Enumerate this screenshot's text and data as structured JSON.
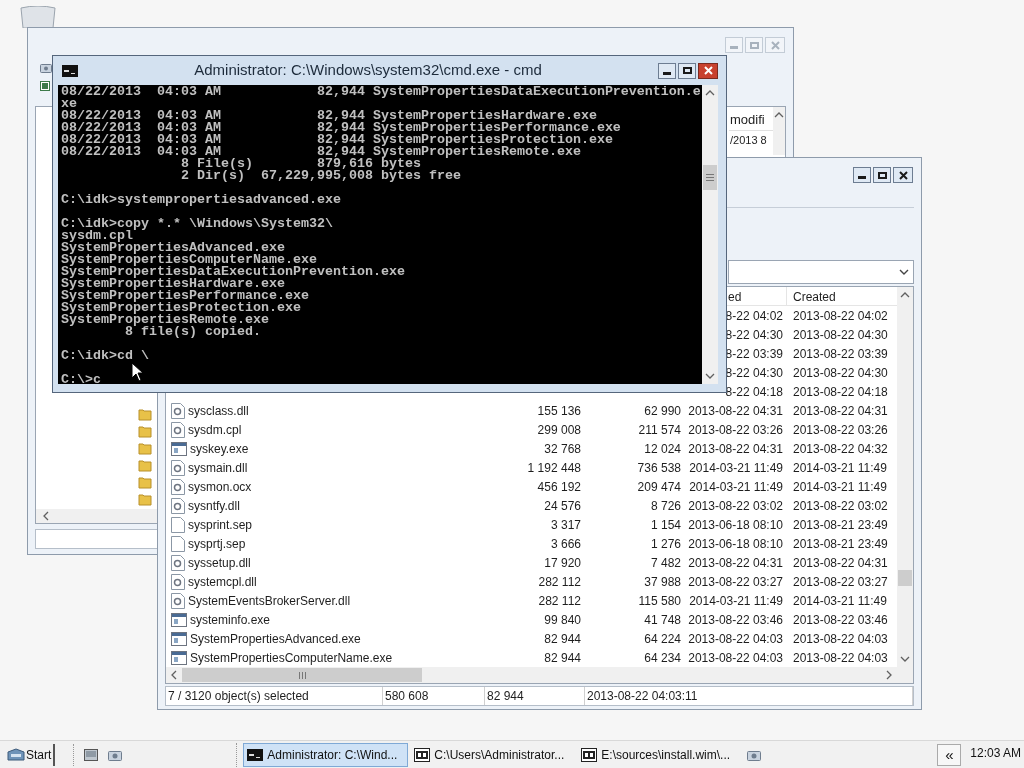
{
  "back_window": {
    "active": false,
    "list_header": "modifi",
    "list_cell": "/2013 8"
  },
  "cmd_window": {
    "title": "Administrator: C:\\Windows\\system32\\cmd.exe - cmd",
    "active": true,
    "blocks": [
      [
        "08/22/2013  04:03 AM            82,944 SystemPropertiesDataExecutionPrevention.e",
        "xe",
        "08/22/2013  04:03 AM            82,944 SystemPropertiesHardware.exe",
        "08/22/2013  04:03 AM            82,944 SystemPropertiesPerformance.exe",
        "08/22/2013  04:03 AM            82,944 SystemPropertiesProtection.exe",
        "08/22/2013  04:03 AM            82,944 SystemPropertiesRemote.exe",
        "               8 File(s)        879,616 bytes",
        "               2 Dir(s)  67,229,995,008 bytes free"
      ],
      [
        "C:\\idk>systempropertiesadvanced.exe"
      ],
      [
        "C:\\idk>copy *.* \\Windows\\System32\\",
        "sysdm.cpl",
        "SystemPropertiesAdvanced.exe",
        "SystemPropertiesComputerName.exe",
        "SystemPropertiesDataExecutionPrevention.exe",
        "SystemPropertiesHardware.exe",
        "SystemPropertiesPerformance.exe",
        "SystemPropertiesProtection.exe",
        "SystemPropertiesRemote.exe",
        "        8 file(s) copied."
      ],
      [
        "C:\\idk>cd \\"
      ],
      [
        "C:\\>c"
      ]
    ]
  },
  "file_window": {
    "active": false,
    "header": {
      "modified": "ed",
      "created": "Created"
    },
    "rows": [
      {
        "modified": "8-22 04:02",
        "created": "2013-08-22 04:02"
      },
      {
        "modified": "8-22 04:30",
        "created": "2013-08-22 04:30"
      },
      {
        "modified": "8-22 03:39",
        "created": "2013-08-22 03:39"
      },
      {
        "modified": "8-22 04:30",
        "created": "2013-08-22 04:30"
      },
      {
        "modified": "8-22 04:18",
        "created": "2013-08-22 04:18"
      },
      {
        "kind": "dll",
        "name": "sysclass.dll",
        "size": "155 136",
        "packed": "62 990",
        "modified": "2013-08-22 04:31",
        "created": "2013-08-22 04:31"
      },
      {
        "kind": "dll",
        "name": "sysdm.cpl",
        "size": "299 008",
        "packed": "211 574",
        "modified": "2013-08-22 03:26",
        "created": "2013-08-22 03:26"
      },
      {
        "kind": "exe",
        "name": "syskey.exe",
        "size": "32 768",
        "packed": "12 024",
        "modified": "2013-08-22 04:31",
        "created": "2013-08-22 04:32"
      },
      {
        "kind": "dll",
        "name": "sysmain.dll",
        "size": "1 192 448",
        "packed": "736 538",
        "modified": "2014-03-21 11:49",
        "created": "2014-03-21 11:49"
      },
      {
        "kind": "dll",
        "name": "sysmon.ocx",
        "size": "456 192",
        "packed": "209 474",
        "modified": "2014-03-21 11:49",
        "created": "2014-03-21 11:49"
      },
      {
        "kind": "dll",
        "name": "sysntfy.dll",
        "size": "24 576",
        "packed": "8 726",
        "modified": "2013-08-22 03:02",
        "created": "2013-08-22 03:02"
      },
      {
        "kind": "file",
        "name": "sysprint.sep",
        "size": "3 317",
        "packed": "1 154",
        "modified": "2013-06-18 08:10",
        "created": "2013-08-21 23:49"
      },
      {
        "kind": "file",
        "name": "sysprtj.sep",
        "size": "3 666",
        "packed": "1 276",
        "modified": "2013-06-18 08:10",
        "created": "2013-08-21 23:49"
      },
      {
        "kind": "dll",
        "name": "syssetup.dll",
        "size": "17 920",
        "packed": "7 482",
        "modified": "2013-08-22 04:31",
        "created": "2013-08-22 04:31"
      },
      {
        "kind": "dll",
        "name": "systemcpl.dll",
        "size": "282 112",
        "packed": "37 988",
        "modified": "2013-08-22 03:27",
        "created": "2013-08-22 03:27"
      },
      {
        "kind": "dll",
        "name": "SystemEventsBrokerServer.dll",
        "size": "282 112",
        "packed": "115 580",
        "modified": "2014-03-21 11:49",
        "created": "2014-03-21 11:49"
      },
      {
        "kind": "exe",
        "name": "systeminfo.exe",
        "size": "99 840",
        "packed": "41 748",
        "modified": "2013-08-22 03:46",
        "created": "2013-08-22 03:46"
      },
      {
        "kind": "exe",
        "name": "SystemPropertiesAdvanced.exe",
        "size": "82 944",
        "packed": "64 224",
        "modified": "2013-08-22 04:03",
        "created": "2013-08-22 04:03"
      },
      {
        "kind": "exe",
        "name": "SystemPropertiesComputerName.exe",
        "size": "82 944",
        "packed": "64 234",
        "modified": "2013-08-22 04:03",
        "created": "2013-08-22 04:03"
      }
    ],
    "status_bar": [
      "7 / 3120 object(s) selected",
      "580 608",
      "82 944",
      "2013-08-22 04:03:11"
    ]
  },
  "taskbar": {
    "start": "Start",
    "tasks": [
      {
        "kind": "console",
        "label": "Administrator: C:\\Wind...",
        "selected": true
      },
      {
        "kind": "archive",
        "label": "C:\\Users\\Administrator...",
        "selected": false
      },
      {
        "kind": "archive",
        "label": "E:\\sources\\install.wim\\...",
        "selected": false
      }
    ],
    "expand_button": "«",
    "clock": "12:03 AM"
  }
}
